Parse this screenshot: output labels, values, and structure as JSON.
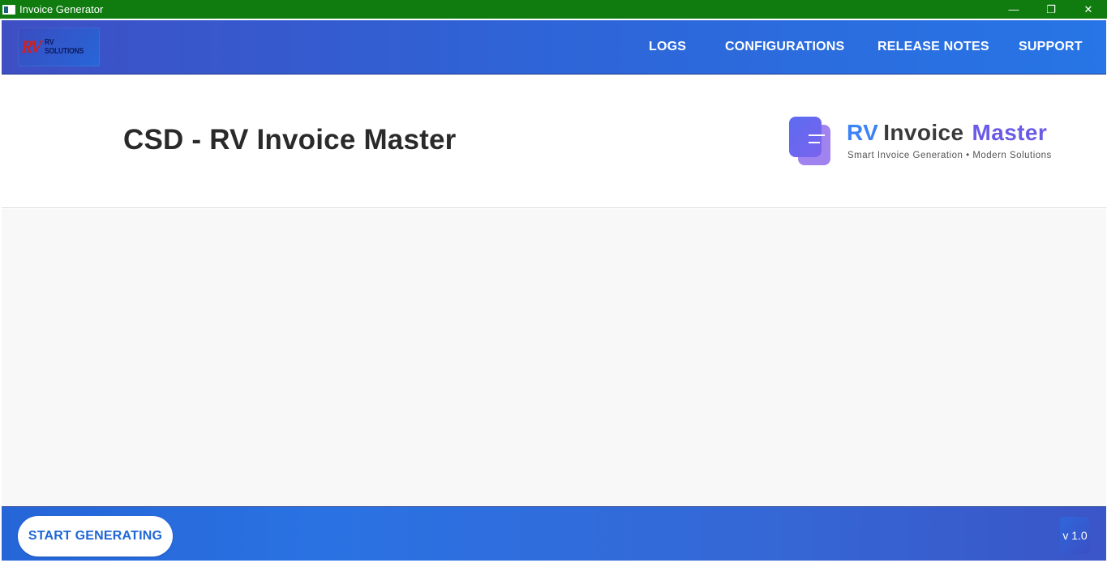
{
  "window": {
    "title": "Invoice Generator",
    "controls": {
      "minimize": "—",
      "restore": "❐",
      "close": "✕"
    },
    "titlebar_color": "#107c10"
  },
  "header": {
    "brand_logo": {
      "mark": "RV",
      "text": "RV SOLUTIONS"
    },
    "nav": [
      {
        "label": "LOGS"
      },
      {
        "label": "CONFIGURATIONS"
      },
      {
        "label": "RELEASE NOTES"
      },
      {
        "label": "SUPPORT"
      }
    ],
    "gradient": [
      "#3e4fc4",
      "#2775e6"
    ]
  },
  "hero": {
    "page_title": "CSD - RV Invoice Master",
    "product_logo": {
      "word_rv": "RV",
      "word_invoice": "Invoice",
      "word_master": "Master",
      "tagline": "Smart Invoice Generation • Modern Solutions",
      "icon": "document-stack-icon"
    }
  },
  "footer": {
    "start_button_label": "START GENERATING",
    "version": "v 1.0"
  },
  "colors": {
    "accent": "#1e66d4",
    "wordmark_blue": "#3b82f6",
    "wordmark_purple": "#6a5be6",
    "content_bg": "#f8f8f8"
  }
}
